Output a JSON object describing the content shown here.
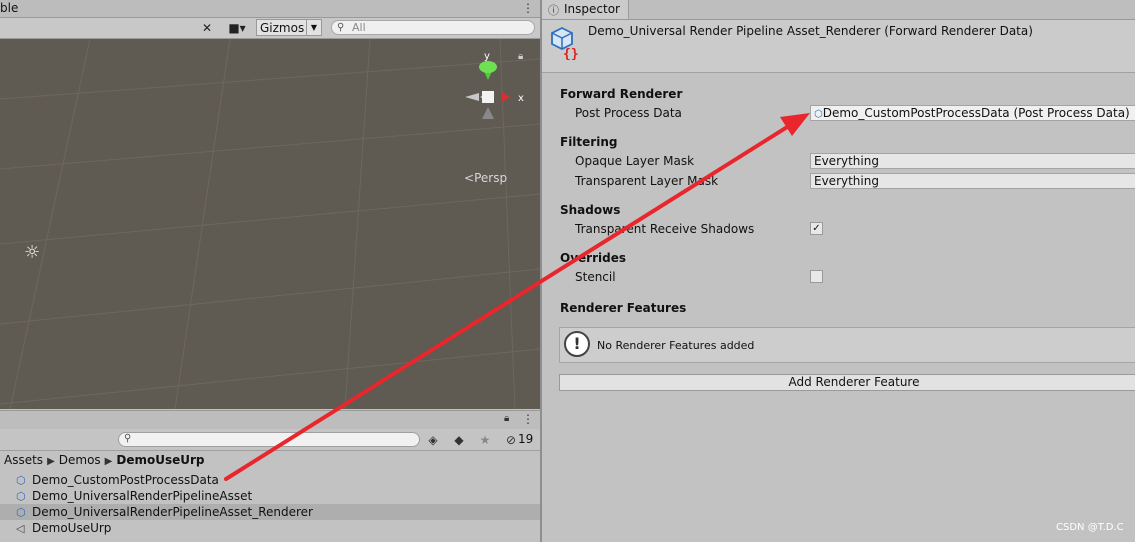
{
  "scene": {
    "tab_title": "ble",
    "gizmos_label": "Gizmos",
    "search_placeholder": "All",
    "persp_label": "Persp",
    "axis_y": "y",
    "axis_x": "x"
  },
  "project": {
    "hidden_count": "19",
    "breadcrumb": [
      "Assets",
      "Demos",
      "DemoUseUrp"
    ],
    "assets": [
      {
        "name": "Demo_CustomPostProcessData",
        "icon": "scriptable-object-icon",
        "selected": false
      },
      {
        "name": "Demo_UniversalRenderPipelineAsset",
        "icon": "scriptable-object-icon",
        "selected": false
      },
      {
        "name": "Demo_UniversalRenderPipelineAsset_Renderer",
        "icon": "scriptable-object-icon",
        "selected": true
      },
      {
        "name": "DemoUseUrp",
        "icon": "scene-icon",
        "selected": false
      }
    ]
  },
  "inspector": {
    "tab_label": "Inspector",
    "title": "Demo_Universal Render Pipeline Asset_Renderer (Forward Renderer Data)",
    "sections": {
      "forward_renderer": "Forward Renderer",
      "filtering": "Filtering",
      "shadows": "Shadows",
      "overrides": "Overrides",
      "renderer_features": "Renderer Features"
    },
    "props": {
      "post_process_label": "Post Process Data",
      "post_process_value": "Demo_CustomPostProcessData (Post Process Data)",
      "opaque_label": "Opaque Layer Mask",
      "opaque_value": "Everything",
      "transparent_label": "Transparent Layer Mask",
      "transparent_value": "Everything",
      "shadows_label": "Transparent Receive Shadows",
      "shadows_checked": true,
      "stencil_label": "Stencil",
      "stencil_checked": false
    },
    "no_features_text": "No Renderer Features added",
    "add_feature_label": "Add Renderer Feature"
  },
  "watermark": "CSDN @T.D.C",
  "colors": {
    "scene_bg": "#5f5a52",
    "arrow": "#e8262b",
    "selection": "#aeaeae",
    "panel_bg": "#c2c2c2"
  }
}
